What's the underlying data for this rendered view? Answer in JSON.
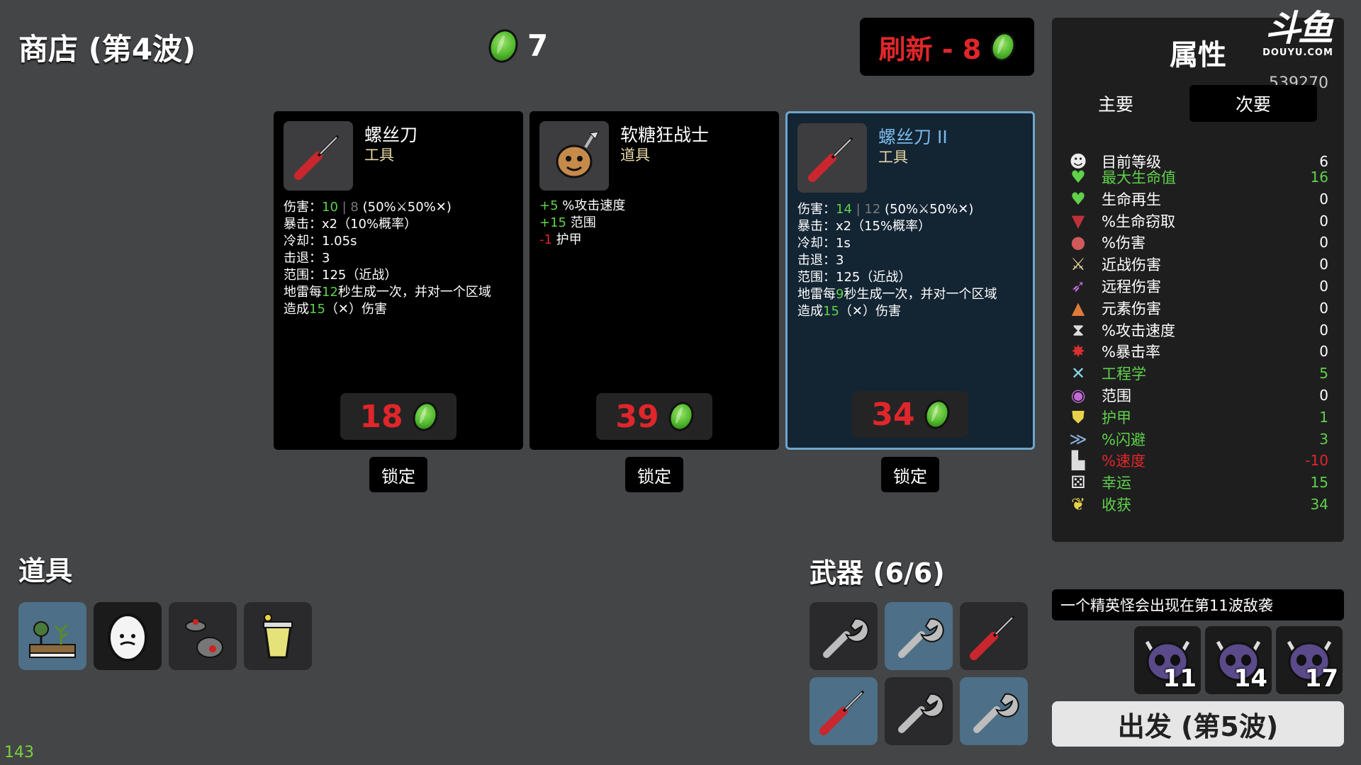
{
  "header": {
    "shop_title": "商店 (第4波)",
    "gold": "7",
    "reroll_label": "刷新 - 8"
  },
  "colors": {
    "background": "#444547",
    "panel": "#1e1e1f",
    "price_red": "#e0262b",
    "positive_green": "#5fd14a",
    "selected_border": "#6fa6cc",
    "item_type": "#e9d9a6"
  },
  "shop": [
    {
      "name": "螺丝刀",
      "type": "工具",
      "icon": "screwdriver-icon",
      "price": "18",
      "lock_label": "锁定",
      "lines": [
        {
          "parts": [
            {
              "t": "伤害：",
              "c": ""
            },
            {
              "t": "10",
              "c": "g"
            },
            {
              "t": " | 8 ",
              "c": "dim"
            },
            {
              "t": "(50%",
              "c": ""
            },
            {
              "t": "⚔",
              "c": ""
            },
            {
              "t": "50%",
              "c": ""
            },
            {
              "t": "✕",
              "c": ""
            },
            {
              "t": ")",
              "c": ""
            }
          ]
        },
        {
          "parts": [
            {
              "t": "暴击：x2（10%概率）",
              "c": ""
            }
          ]
        },
        {
          "parts": [
            {
              "t": "冷却：1.05s",
              "c": ""
            }
          ]
        },
        {
          "parts": [
            {
              "t": "击退：3",
              "c": ""
            }
          ]
        },
        {
          "parts": [
            {
              "t": "范围：125（近战）",
              "c": ""
            }
          ]
        },
        {
          "parts": [
            {
              "t": "地雷每",
              "c": ""
            },
            {
              "t": "12",
              "c": "g"
            },
            {
              "t": "秒生成一次，并对一个区域",
              "c": ""
            }
          ]
        },
        {
          "parts": [
            {
              "t": "造成",
              "c": ""
            },
            {
              "t": "15",
              "c": "g"
            },
            {
              "t": "（",
              "c": ""
            },
            {
              "t": "✕",
              "c": ""
            },
            {
              "t": "）伤害",
              "c": ""
            }
          ]
        }
      ]
    },
    {
      "name": "软糖狂战士",
      "type": "道具",
      "icon": "gummy-berserker-icon",
      "price": "39",
      "lock_label": "锁定",
      "lines": [
        {
          "parts": [
            {
              "t": "+5",
              "c": "g"
            },
            {
              "t": " %攻击速度",
              "c": ""
            }
          ]
        },
        {
          "parts": [
            {
              "t": "+15",
              "c": "g"
            },
            {
              "t": " 范围",
              "c": ""
            }
          ]
        },
        {
          "parts": [
            {
              "t": "-1",
              "c": "r"
            },
            {
              "t": " 护甲",
              "c": ""
            }
          ]
        }
      ]
    },
    {
      "name": "螺丝刀 II",
      "type": "工具",
      "icon": "screwdriver-icon",
      "price": "34",
      "lock_label": "锁定",
      "lines": [
        {
          "parts": [
            {
              "t": "伤害：",
              "c": ""
            },
            {
              "t": "14",
              "c": "g"
            },
            {
              "t": " | 12 ",
              "c": "dim"
            },
            {
              "t": "(50%",
              "c": ""
            },
            {
              "t": "⚔",
              "c": ""
            },
            {
              "t": "50%",
              "c": ""
            },
            {
              "t": "✕",
              "c": ""
            },
            {
              "t": ")",
              "c": ""
            }
          ]
        },
        {
          "parts": [
            {
              "t": "暴击：x2（15%概率）",
              "c": ""
            }
          ]
        },
        {
          "parts": [
            {
              "t": "冷却：1s",
              "c": ""
            }
          ]
        },
        {
          "parts": [
            {
              "t": "击退：3",
              "c": ""
            }
          ]
        },
        {
          "parts": [
            {
              "t": "范围：125（近战）",
              "c": ""
            }
          ]
        },
        {
          "parts": [
            {
              "t": "地雷每",
              "c": ""
            },
            {
              "t": "9",
              "c": "g"
            },
            {
              "t": "秒生成一次，并对一个区域",
              "c": ""
            }
          ]
        },
        {
          "parts": [
            {
              "t": "造成",
              "c": ""
            },
            {
              "t": "15",
              "c": "g"
            },
            {
              "t": "（",
              "c": ""
            },
            {
              "t": "✕",
              "c": ""
            },
            {
              "t": "）伤害",
              "c": ""
            }
          ]
        }
      ]
    }
  ],
  "items": {
    "title": "道具",
    "slots": [
      "garden-icon",
      "egg-face-icon",
      "landmine-icon",
      "lemonade-cup-icon"
    ]
  },
  "weapons": {
    "title": "武器 (6/6)",
    "slots": [
      {
        "icon": "wrench-icon",
        "tier": "grey"
      },
      {
        "icon": "wrench-icon",
        "tier": "blue"
      },
      {
        "icon": "screwdriver-icon",
        "tier": "grey"
      },
      {
        "icon": "screwdriver-icon",
        "tier": "blue"
      },
      {
        "icon": "wrench-icon",
        "tier": "grey"
      },
      {
        "icon": "wrench-icon",
        "tier": "blue"
      }
    ]
  },
  "stats": {
    "title": "属性",
    "tabs": [
      "主要",
      "次要"
    ],
    "watermark": {
      "logo": "斗鱼",
      "sub": "DOUYU.COM",
      "room": "539270"
    },
    "rows": [
      {
        "icon": "level-icon",
        "label": "目前等级",
        "value": "6",
        "tone": ""
      },
      {
        "icon": "heart-icon",
        "label": "最大生命值",
        "value": "16",
        "tone": "good"
      },
      {
        "icon": "heart-plus-icon",
        "label": "生命再生",
        "value": "0",
        "tone": ""
      },
      {
        "icon": "fang-icon",
        "label": "%生命窃取",
        "value": "0",
        "tone": ""
      },
      {
        "icon": "muscle-icon",
        "label": "%伤害",
        "value": "0",
        "tone": ""
      },
      {
        "icon": "sword-icon",
        "label": "近战伤害",
        "value": "0",
        "tone": ""
      },
      {
        "icon": "bow-icon",
        "label": "远程伤害",
        "value": "0",
        "tone": ""
      },
      {
        "icon": "flame-icon",
        "label": "元素伤害",
        "value": "0",
        "tone": ""
      },
      {
        "icon": "hourglass-icon",
        "label": "%攻击速度",
        "value": "0",
        "tone": ""
      },
      {
        "icon": "crit-burst-icon",
        "label": "%暴击率",
        "value": "0",
        "tone": ""
      },
      {
        "icon": "engineering-icon",
        "label": "工程学",
        "value": "5",
        "tone": "good"
      },
      {
        "icon": "range-icon",
        "label": "范围",
        "value": "0",
        "tone": ""
      },
      {
        "icon": "shield-icon",
        "label": "护甲",
        "value": "1",
        "tone": "good"
      },
      {
        "icon": "dodge-icon",
        "label": "%闪避",
        "value": "3",
        "tone": "good"
      },
      {
        "icon": "boot-icon",
        "label": "%速度",
        "value": "-10",
        "tone": "bad"
      },
      {
        "icon": "dice-icon",
        "label": "幸运",
        "value": "15",
        "tone": "good"
      },
      {
        "icon": "harvest-icon",
        "label": "收获",
        "value": "34",
        "tone": "good"
      }
    ]
  },
  "elite_notice": "一个精英怪会出现在第11波敌袭",
  "elite_waves": [
    "11",
    "14",
    "17"
  ],
  "go_button": "出发 (第5波)",
  "fps": "143"
}
